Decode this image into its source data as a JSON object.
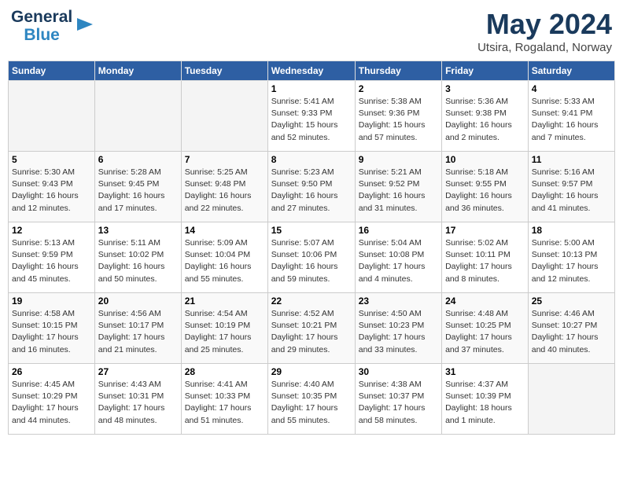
{
  "header": {
    "logo_line1": "General",
    "logo_line2": "Blue",
    "month_year": "May 2024",
    "location": "Utsira, Rogaland, Norway"
  },
  "days_of_week": [
    "Sunday",
    "Monday",
    "Tuesday",
    "Wednesday",
    "Thursday",
    "Friday",
    "Saturday"
  ],
  "weeks": [
    [
      {
        "day": "",
        "sunrise": "",
        "sunset": "",
        "daylight": ""
      },
      {
        "day": "",
        "sunrise": "",
        "sunset": "",
        "daylight": ""
      },
      {
        "day": "",
        "sunrise": "",
        "sunset": "",
        "daylight": ""
      },
      {
        "day": "1",
        "sunrise": "Sunrise: 5:41 AM",
        "sunset": "Sunset: 9:33 PM",
        "daylight": "Daylight: 15 hours and 52 minutes."
      },
      {
        "day": "2",
        "sunrise": "Sunrise: 5:38 AM",
        "sunset": "Sunset: 9:36 PM",
        "daylight": "Daylight: 15 hours and 57 minutes."
      },
      {
        "day": "3",
        "sunrise": "Sunrise: 5:36 AM",
        "sunset": "Sunset: 9:38 PM",
        "daylight": "Daylight: 16 hours and 2 minutes."
      },
      {
        "day": "4",
        "sunrise": "Sunrise: 5:33 AM",
        "sunset": "Sunset: 9:41 PM",
        "daylight": "Daylight: 16 hours and 7 minutes."
      }
    ],
    [
      {
        "day": "5",
        "sunrise": "Sunrise: 5:30 AM",
        "sunset": "Sunset: 9:43 PM",
        "daylight": "Daylight: 16 hours and 12 minutes."
      },
      {
        "day": "6",
        "sunrise": "Sunrise: 5:28 AM",
        "sunset": "Sunset: 9:45 PM",
        "daylight": "Daylight: 16 hours and 17 minutes."
      },
      {
        "day": "7",
        "sunrise": "Sunrise: 5:25 AM",
        "sunset": "Sunset: 9:48 PM",
        "daylight": "Daylight: 16 hours and 22 minutes."
      },
      {
        "day": "8",
        "sunrise": "Sunrise: 5:23 AM",
        "sunset": "Sunset: 9:50 PM",
        "daylight": "Daylight: 16 hours and 27 minutes."
      },
      {
        "day": "9",
        "sunrise": "Sunrise: 5:21 AM",
        "sunset": "Sunset: 9:52 PM",
        "daylight": "Daylight: 16 hours and 31 minutes."
      },
      {
        "day": "10",
        "sunrise": "Sunrise: 5:18 AM",
        "sunset": "Sunset: 9:55 PM",
        "daylight": "Daylight: 16 hours and 36 minutes."
      },
      {
        "day": "11",
        "sunrise": "Sunrise: 5:16 AM",
        "sunset": "Sunset: 9:57 PM",
        "daylight": "Daylight: 16 hours and 41 minutes."
      }
    ],
    [
      {
        "day": "12",
        "sunrise": "Sunrise: 5:13 AM",
        "sunset": "Sunset: 9:59 PM",
        "daylight": "Daylight: 16 hours and 45 minutes."
      },
      {
        "day": "13",
        "sunrise": "Sunrise: 5:11 AM",
        "sunset": "Sunset: 10:02 PM",
        "daylight": "Daylight: 16 hours and 50 minutes."
      },
      {
        "day": "14",
        "sunrise": "Sunrise: 5:09 AM",
        "sunset": "Sunset: 10:04 PM",
        "daylight": "Daylight: 16 hours and 55 minutes."
      },
      {
        "day": "15",
        "sunrise": "Sunrise: 5:07 AM",
        "sunset": "Sunset: 10:06 PM",
        "daylight": "Daylight: 16 hours and 59 minutes."
      },
      {
        "day": "16",
        "sunrise": "Sunrise: 5:04 AM",
        "sunset": "Sunset: 10:08 PM",
        "daylight": "Daylight: 17 hours and 4 minutes."
      },
      {
        "day": "17",
        "sunrise": "Sunrise: 5:02 AM",
        "sunset": "Sunset: 10:11 PM",
        "daylight": "Daylight: 17 hours and 8 minutes."
      },
      {
        "day": "18",
        "sunrise": "Sunrise: 5:00 AM",
        "sunset": "Sunset: 10:13 PM",
        "daylight": "Daylight: 17 hours and 12 minutes."
      }
    ],
    [
      {
        "day": "19",
        "sunrise": "Sunrise: 4:58 AM",
        "sunset": "Sunset: 10:15 PM",
        "daylight": "Daylight: 17 hours and 16 minutes."
      },
      {
        "day": "20",
        "sunrise": "Sunrise: 4:56 AM",
        "sunset": "Sunset: 10:17 PM",
        "daylight": "Daylight: 17 hours and 21 minutes."
      },
      {
        "day": "21",
        "sunrise": "Sunrise: 4:54 AM",
        "sunset": "Sunset: 10:19 PM",
        "daylight": "Daylight: 17 hours and 25 minutes."
      },
      {
        "day": "22",
        "sunrise": "Sunrise: 4:52 AM",
        "sunset": "Sunset: 10:21 PM",
        "daylight": "Daylight: 17 hours and 29 minutes."
      },
      {
        "day": "23",
        "sunrise": "Sunrise: 4:50 AM",
        "sunset": "Sunset: 10:23 PM",
        "daylight": "Daylight: 17 hours and 33 minutes."
      },
      {
        "day": "24",
        "sunrise": "Sunrise: 4:48 AM",
        "sunset": "Sunset: 10:25 PM",
        "daylight": "Daylight: 17 hours and 37 minutes."
      },
      {
        "day": "25",
        "sunrise": "Sunrise: 4:46 AM",
        "sunset": "Sunset: 10:27 PM",
        "daylight": "Daylight: 17 hours and 40 minutes."
      }
    ],
    [
      {
        "day": "26",
        "sunrise": "Sunrise: 4:45 AM",
        "sunset": "Sunset: 10:29 PM",
        "daylight": "Daylight: 17 hours and 44 minutes."
      },
      {
        "day": "27",
        "sunrise": "Sunrise: 4:43 AM",
        "sunset": "Sunset: 10:31 PM",
        "daylight": "Daylight: 17 hours and 48 minutes."
      },
      {
        "day": "28",
        "sunrise": "Sunrise: 4:41 AM",
        "sunset": "Sunset: 10:33 PM",
        "daylight": "Daylight: 17 hours and 51 minutes."
      },
      {
        "day": "29",
        "sunrise": "Sunrise: 4:40 AM",
        "sunset": "Sunset: 10:35 PM",
        "daylight": "Daylight: 17 hours and 55 minutes."
      },
      {
        "day": "30",
        "sunrise": "Sunrise: 4:38 AM",
        "sunset": "Sunset: 10:37 PM",
        "daylight": "Daylight: 17 hours and 58 minutes."
      },
      {
        "day": "31",
        "sunrise": "Sunrise: 4:37 AM",
        "sunset": "Sunset: 10:39 PM",
        "daylight": "Daylight: 18 hours and 1 minute."
      },
      {
        "day": "",
        "sunrise": "",
        "sunset": "",
        "daylight": ""
      }
    ]
  ]
}
